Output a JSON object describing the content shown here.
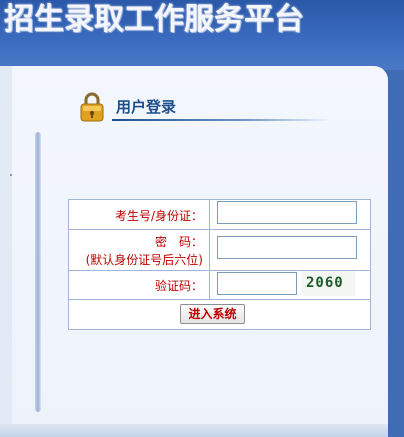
{
  "banner": {
    "title": "招生录取工作服务平台"
  },
  "login": {
    "heading": "用户登录",
    "id_label": "考生号/身份证：",
    "id_value": "",
    "password_label": "密　码：",
    "password_hint": "(默认身份证号后六位)",
    "password_value": "",
    "captcha_label": "验证码：",
    "captcha_value": "",
    "captcha_image_text": "2060",
    "submit_label": "进入系统"
  },
  "colors": {
    "banner_blue": "#2b58a8",
    "heading_blue": "#1e4f8c",
    "label_red": "#c00000",
    "table_border": "#9fb6d6"
  }
}
